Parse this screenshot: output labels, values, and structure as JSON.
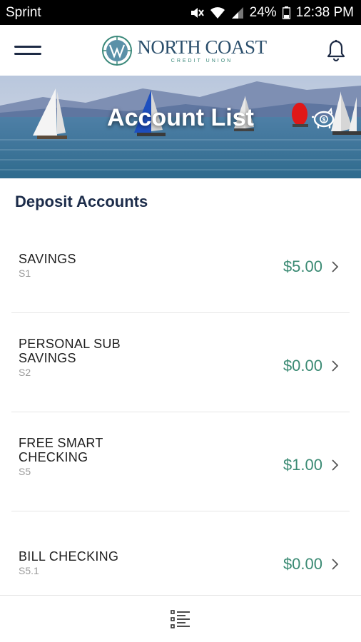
{
  "status_bar": {
    "carrier": "Sprint",
    "battery": "24%",
    "time": "12:38 PM"
  },
  "header": {
    "logo_name": "NORTH COAST",
    "logo_sub": "CREDIT UNION",
    "menu_icon": "hamburger-icon",
    "notification_icon": "bell-icon"
  },
  "banner": {
    "title": "Account List",
    "icon": "piggy-bank-icon"
  },
  "section": {
    "title": "Deposit Accounts"
  },
  "accounts": [
    {
      "name": "SAVINGS",
      "id": "S1",
      "balance": "$5.00"
    },
    {
      "name": "PERSONAL SUB SAVINGS",
      "id": "S2",
      "balance": "$0.00"
    },
    {
      "name": "FREE SMART CHECKING",
      "id": "S5",
      "balance": "$1.00"
    },
    {
      "name": "BILL CHECKING",
      "id": "S5.1",
      "balance": "$0.00"
    }
  ],
  "bottom_bar": {
    "icon": "list-icon"
  },
  "colors": {
    "navy": "#1c2c4a",
    "balance_green": "#3a8a73",
    "logo_teal": "#3d8a7c"
  }
}
